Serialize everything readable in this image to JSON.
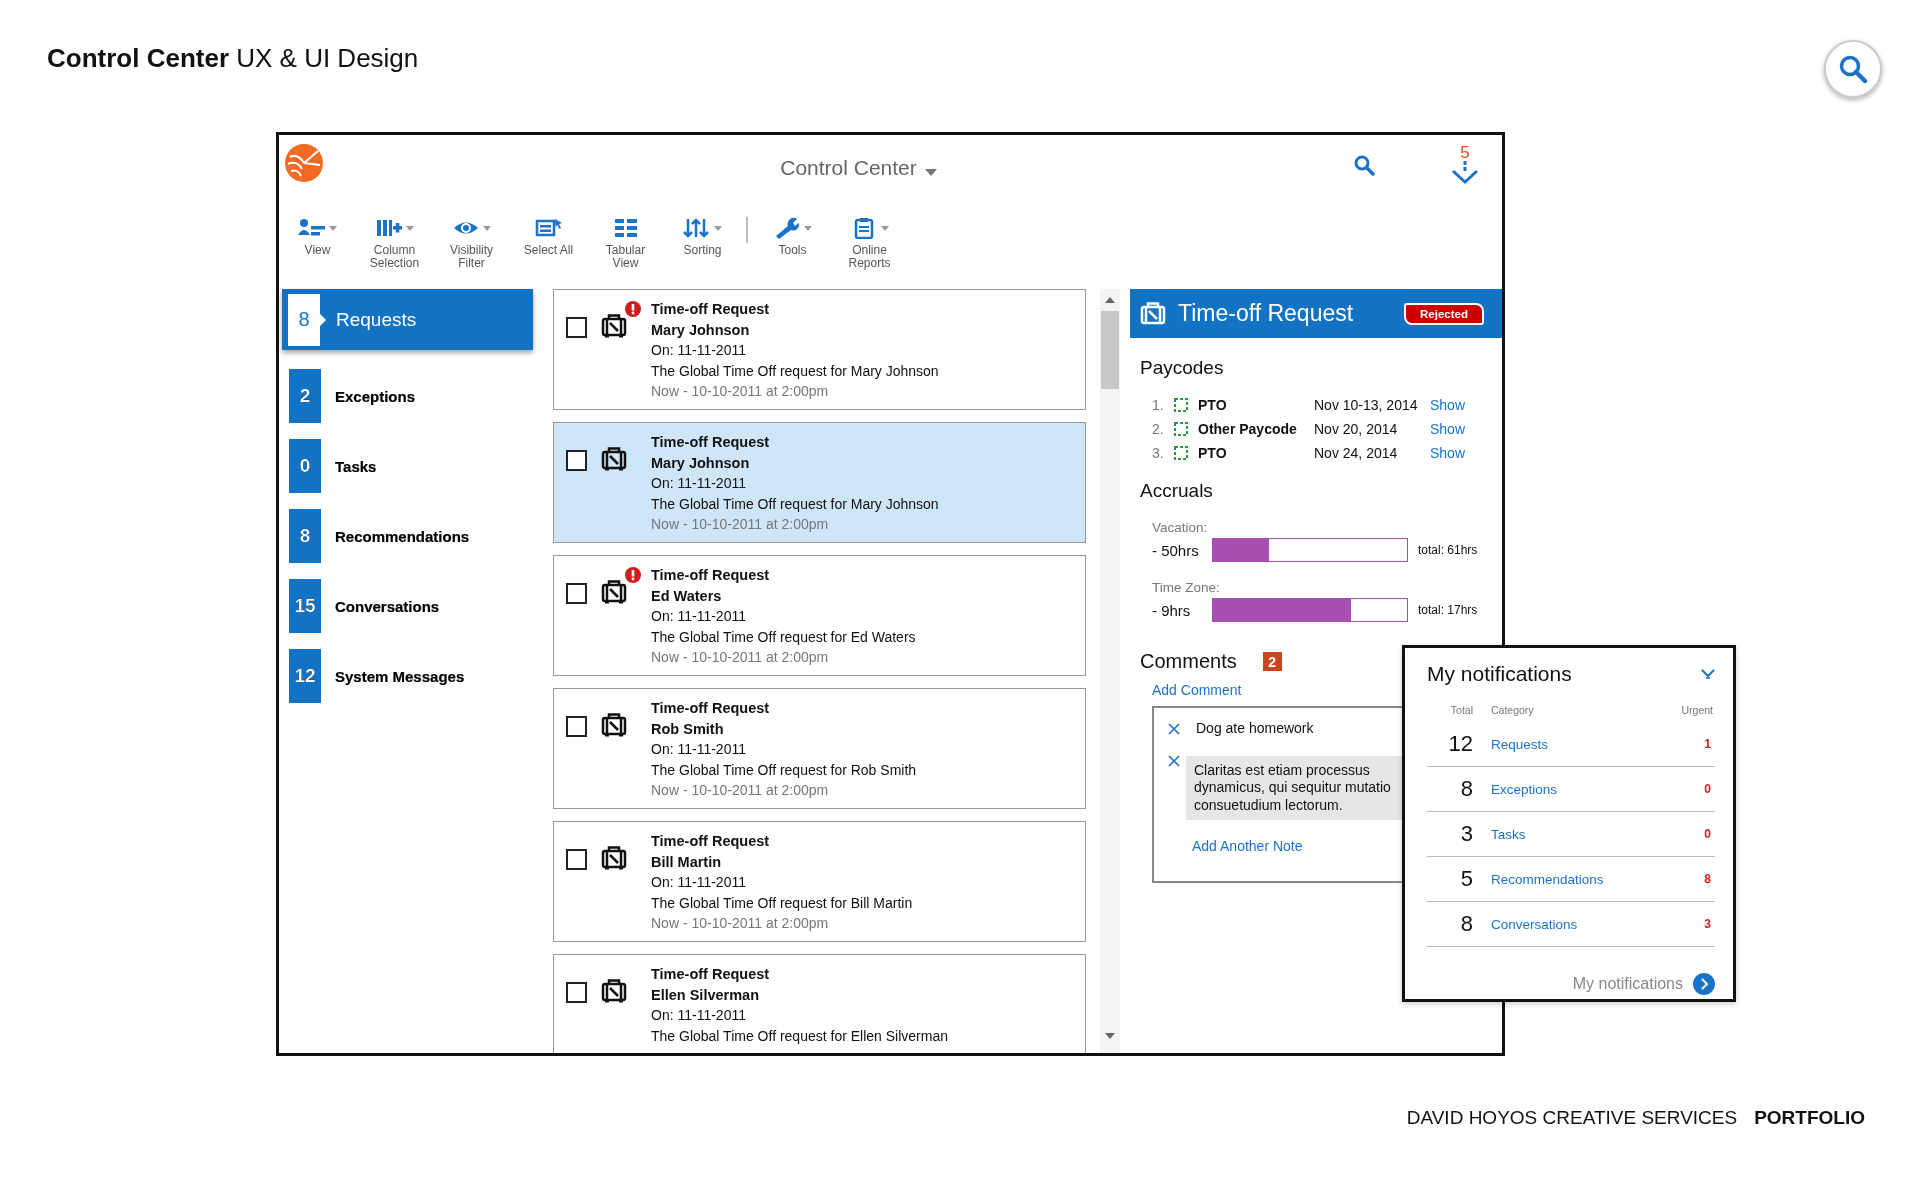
{
  "page": {
    "title": "**Control Center** UX & UI Design"
  },
  "app": {
    "title": "Control Center",
    "alert_count": "5"
  },
  "toolbar": [
    {
      "label": "View",
      "kind": "view",
      "dropdown": true
    },
    {
      "label": "Column\nSelection",
      "kind": "columns",
      "dropdown": true
    },
    {
      "label": "Visibility\nFilter",
      "kind": "eye",
      "dropdown": true
    },
    {
      "label": "Select All",
      "kind": "select",
      "dropdown": false
    },
    {
      "label": "Tabular\nView",
      "kind": "grid",
      "dropdown": false
    },
    {
      "label": "Sorting",
      "kind": "sort",
      "dropdown": true
    },
    {
      "label": "Tools",
      "kind": "wrench",
      "dropdown": true
    },
    {
      "label": "Online\nReports",
      "kind": "clipboard",
      "dropdown": true
    }
  ],
  "sidebar": [
    {
      "count": "8",
      "label": "Requests",
      "selected": true
    },
    {
      "count": "2",
      "label": "Exceptions",
      "selected": false
    },
    {
      "count": "0",
      "label": "Tasks",
      "selected": false
    },
    {
      "count": "8",
      "label": "Recommendations",
      "selected": false
    },
    {
      "count": "15",
      "label": "Conversations",
      "selected": false
    },
    {
      "count": "12",
      "label": "System Messages",
      "selected": false
    }
  ],
  "requests": [
    {
      "title": "Time-off Request",
      "name": "Mary Johnson",
      "on": "On: 11-11-2011",
      "description": "The Global Time Off request for Mary Johnson",
      "time": "Now - 10-10-2011 at 2:00pm",
      "urgent": true,
      "selected": false,
      "checked": false
    },
    {
      "title": "Time-off Request",
      "name": "Mary Johnson",
      "on": "On: 11-11-2011",
      "description": "The Global Time Off request for Mary Johnson",
      "time": "Now - 10-10-2011 at 2:00pm",
      "urgent": false,
      "selected": true,
      "checked": false
    },
    {
      "title": "Time-off Request",
      "name": "Ed Waters",
      "on": "On: 11-11-2011",
      "description": "The Global Time Off request for Ed Waters",
      "time": "Now - 10-10-2011 at 2:00pm",
      "urgent": true,
      "selected": false,
      "checked": false
    },
    {
      "title": "Time-off Request",
      "name": "Rob Smith",
      "on": "On: 11-11-2011",
      "description": "The Global Time Off request for Rob Smith",
      "time": "Now - 10-10-2011 at 2:00pm",
      "urgent": false,
      "selected": false,
      "checked": false
    },
    {
      "title": "Time-off Request",
      "name": "Bill Martin",
      "on": "On: 11-11-2011",
      "description": "The Global Time Off request for Bill Martin",
      "time": "Now - 10-10-2011 at 2:00pm",
      "urgent": false,
      "selected": false,
      "checked": false
    },
    {
      "title": "Time-off Request",
      "name": "Ellen Silverman",
      "on": "On: 11-11-2011",
      "description": "The Global Time Off request for Ellen Silverman",
      "urgent": false,
      "selected": false,
      "checked": false
    }
  ],
  "detail": {
    "title": "Time-off Request",
    "status": "Rejected",
    "paycodes": {
      "heading": "Paycodes",
      "items": [
        {
          "index": "1.",
          "name": "PTO",
          "date": "Nov 10-13, 2014",
          "link": "Show"
        },
        {
          "index": "2.",
          "name": "Other Paycode",
          "date": "Nov 20, 2014",
          "link": "Show"
        },
        {
          "index": "3.",
          "name": "PTO",
          "date": "Nov 24, 2014",
          "link": "Show"
        }
      ]
    },
    "accruals": {
      "heading": "Accruals",
      "items": [
        {
          "label": "Vacation:",
          "amount": "- 50hrs",
          "level": 0.29,
          "total": "total: 61hrs"
        },
        {
          "label": "Time Zone:",
          "amount": "- 9hrs",
          "level": 0.71,
          "total": "total: 17hrs"
        }
      ]
    },
    "comments": {
      "heading": "Comments",
      "count": "2",
      "add_link": "Add Comment",
      "notes": [
        {
          "text": "Dog ate homework",
          "kind": "plain"
        },
        {
          "text": "Claritas est etiam processus\ndynamicus, qui sequitur mutatio\nconsuetudium lectorum.",
          "kind": "highlighted"
        }
      ],
      "add_note_link": "Add Another Note"
    }
  },
  "notifications": {
    "title": "My notifications",
    "columns": [
      "Total",
      "Category",
      "Urgent"
    ],
    "rows": [
      {
        "total": "12",
        "category": "Requests",
        "urgent": "1"
      },
      {
        "total": "8",
        "category": "Exceptions",
        "urgent": "0"
      },
      {
        "total": "3",
        "category": "Tasks",
        "urgent": "0"
      },
      {
        "total": "5",
        "category": "Recommendations",
        "urgent": "8"
      },
      {
        "total": "8",
        "category": "Conversations",
        "urgent": "3"
      }
    ],
    "footer_link": "My notifications"
  },
  "footer": {
    "text": "DAVID HOYOS CREATIVE SERVICES",
    "emphasis": "PORTFOLIO"
  }
}
